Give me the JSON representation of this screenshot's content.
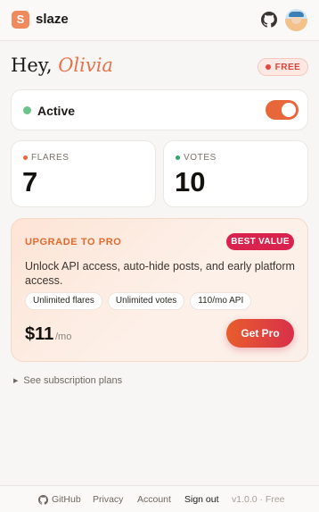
{
  "header": {
    "logo_letter": "S",
    "brand": "slaze",
    "github_icon": "github-icon",
    "avatar_icon": "user-avatar"
  },
  "greeting": {
    "hey": "Hey,",
    "name": "Olivia"
  },
  "plan_badge": "FREE",
  "status": {
    "label": "Active",
    "toggle_on": true
  },
  "stats": {
    "flares": {
      "label": "FLARES",
      "value": "7",
      "dot_color": "#e8673a"
    },
    "votes": {
      "label": "VOTES",
      "value": "10",
      "dot_color": "#2fa86a"
    }
  },
  "pro": {
    "title": "UPGRADE TO PRO",
    "badge": "BEST VALUE",
    "description": "Unlock API access, auto-hide posts, and early platform access.",
    "chips": [
      "Unlimited flares",
      "Unlimited votes",
      "110/mo API"
    ],
    "price": "$11",
    "per": "/mo",
    "cta": "Get Pro"
  },
  "subscription_link": "See subscription plans",
  "footer": {
    "github": "GitHub",
    "privacy": "Privacy",
    "account": "Account",
    "signout": "Sign out",
    "version": "v1.0.0 · Free"
  },
  "colors": {
    "accent": "#e8673a",
    "pro_badge": "#d8234f",
    "active_dot": "#6cc48c"
  }
}
